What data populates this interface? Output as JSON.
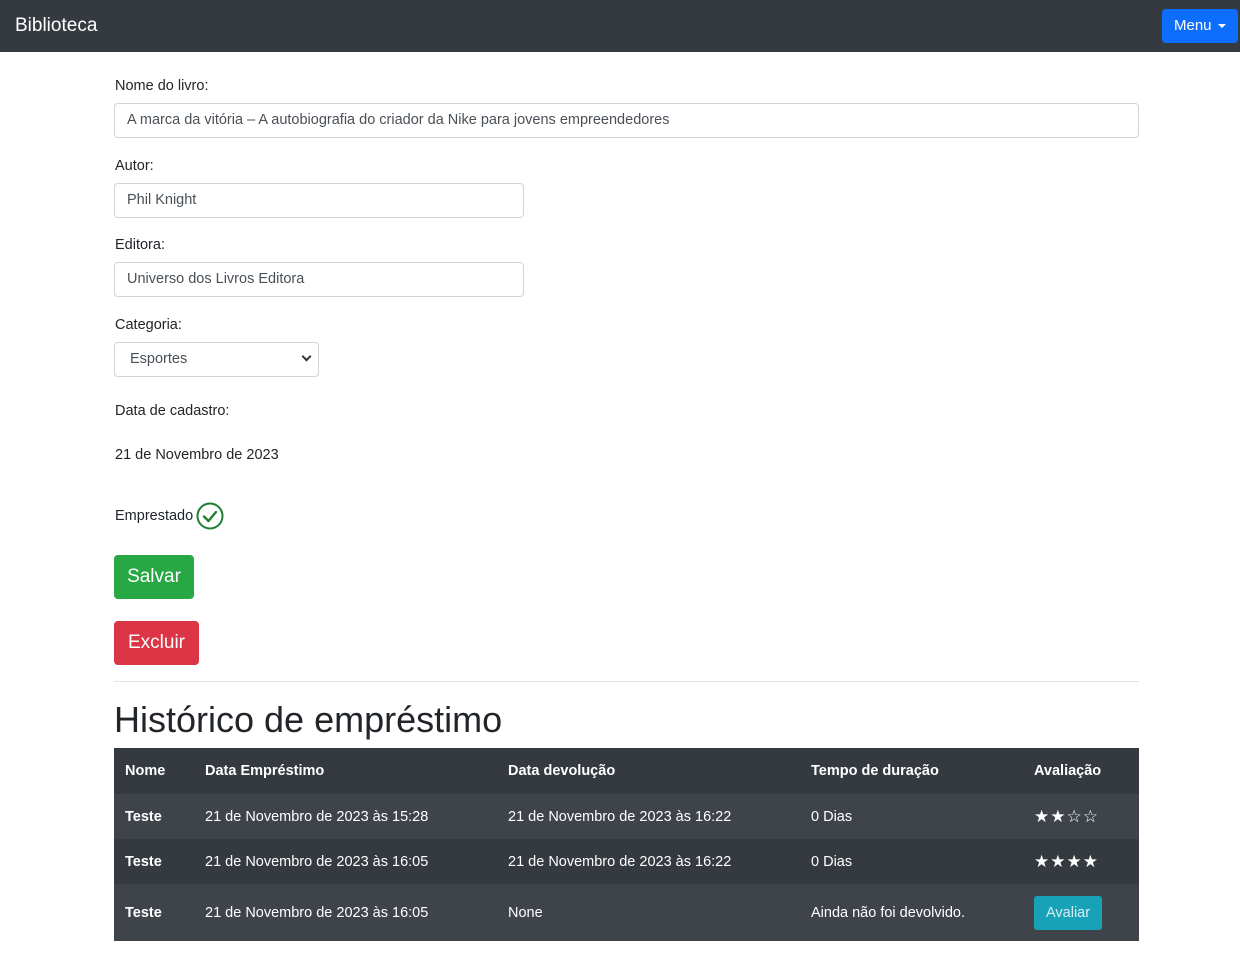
{
  "navbar": {
    "brand": "Biblioteca",
    "menu_label": "Menu"
  },
  "form": {
    "title_label": "Nome do livro:",
    "title_value": "A marca da vitória – A autobiografia do criador da Nike para jovens empreendedores",
    "author_label": "Autor:",
    "author_value": "Phil Knight",
    "publisher_label": "Editora:",
    "publisher_value": "Universo dos Livros Editora",
    "category_label": "Categoria:",
    "category_value": "Esportes",
    "registered_label": "Data de cadastro:",
    "registered_value": "21 de Novembro de 2023",
    "loaned_label": "Emprestado",
    "loaned_icon": "check-circle-icon",
    "save_label": "Salvar",
    "delete_label": "Excluir"
  },
  "history": {
    "title": "Histórico de empréstimo",
    "columns": [
      "Nome",
      "Data Empréstimo",
      "Data devolução",
      "Tempo de duração",
      "Avaliação"
    ],
    "rows": [
      {
        "name": "Teste",
        "loan_date": "21 de Novembro de 2023 às 15:28",
        "return_date": "21 de Novembro de 2023 às 16:22",
        "duration": "0 Dias",
        "rating": 2,
        "rating_max": 4
      },
      {
        "name": "Teste",
        "loan_date": "21 de Novembro de 2023 às 16:05",
        "return_date": "21 de Novembro de 2023 às 16:22",
        "duration": "0 Dias",
        "rating": 4,
        "rating_max": 4
      },
      {
        "name": "Teste",
        "loan_date": "21 de Novembro de 2023 às 16:05",
        "return_date": "None",
        "duration": "Ainda não foi devolvido.",
        "action_label": "Avaliar"
      }
    ]
  },
  "colors": {
    "navbar": "#343a40",
    "menu": "#0d6efd",
    "save": "#28a745",
    "delete": "#dc3545",
    "rate": "#17a2b8",
    "check": "#1e7e34"
  }
}
